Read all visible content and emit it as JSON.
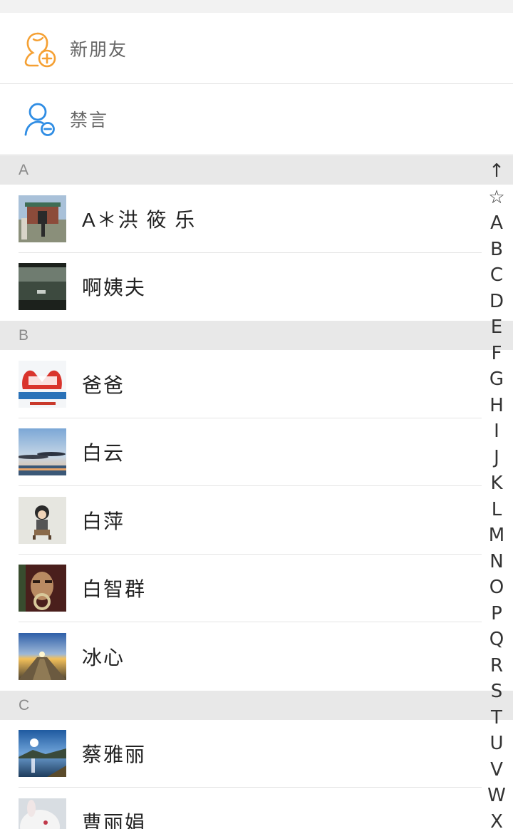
{
  "special_rows": [
    {
      "label": "新朋友",
      "icon": "add-friend-icon",
      "color": "#f5a033"
    },
    {
      "label": "禁言",
      "icon": "muted-user-icon",
      "color": "#2f8de4"
    }
  ],
  "sections": [
    {
      "letter": "A",
      "contacts": [
        {
          "name": "A＊洪 筱 乐",
          "avatar": "gate-photo"
        },
        {
          "name": "啊姨夫",
          "avatar": "road-photo"
        }
      ]
    },
    {
      "letter": "B",
      "contacts": [
        {
          "name": "爸爸",
          "avatar": "heart-hands-photo"
        },
        {
          "name": "白云",
          "avatar": "sea-sky-photo"
        },
        {
          "name": "白萍",
          "avatar": "cartoon-photo"
        },
        {
          "name": "白智群",
          "avatar": "portrait-photo"
        },
        {
          "name": "冰心",
          "avatar": "sunset-photo"
        }
      ]
    },
    {
      "letter": "C",
      "contacts": [
        {
          "name": "蔡雅丽",
          "avatar": "lake-photo"
        },
        {
          "name": "曹丽娟",
          "avatar": "rabbit-photo"
        }
      ]
    }
  ],
  "index_bar": [
    "↑",
    "☆",
    "A",
    "B",
    "C",
    "D",
    "E",
    "F",
    "G",
    "H",
    "I",
    "J",
    "K",
    "L",
    "M",
    "N",
    "O",
    "P",
    "Q",
    "R",
    "S",
    "T",
    "U",
    "V",
    "W",
    "X"
  ]
}
